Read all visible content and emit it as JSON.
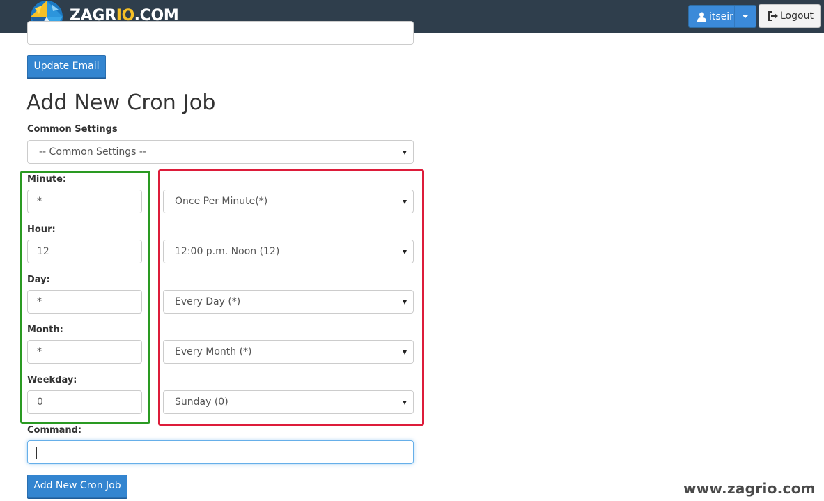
{
  "header": {
    "brand_prefix": "ZAGR",
    "brand_accent": "IO",
    "brand_suffix": ".COM",
    "brand_accent_color": "#f6c026",
    "navbar_color": "#2f3e4c",
    "user_menu_label": "itseir",
    "user_icon": "user-icon",
    "logout_label": "Logout",
    "logout_icon": "sign-out-icon"
  },
  "email_section": {
    "update_button_label": "Update Email"
  },
  "cron_form": {
    "title": "Add New Cron Job",
    "common_settings_label": "Common Settings",
    "common_settings_selected": "-- Common Settings --",
    "fields": [
      {
        "label": "Minute:",
        "value": "*",
        "select_value": "Once Per Minute(*)"
      },
      {
        "label": "Hour:",
        "value": "12",
        "select_value": "12:00 p.m. Noon (12)"
      },
      {
        "label": "Day:",
        "value": "*",
        "select_value": "Every Day (*)"
      },
      {
        "label": "Month:",
        "value": "*",
        "select_value": "Every Month (*)"
      },
      {
        "label": "Weekday:",
        "value": "0",
        "select_value": "Sunday (0)"
      }
    ],
    "command_label": "Command:",
    "command_value": "",
    "submit_label": "Add New Cron Job"
  },
  "annotations": {
    "input_group_highlight_color": "#2a9a22",
    "select_group_highlight_color": "#dd1c3a"
  },
  "watermark": "www.zagrio.com"
}
